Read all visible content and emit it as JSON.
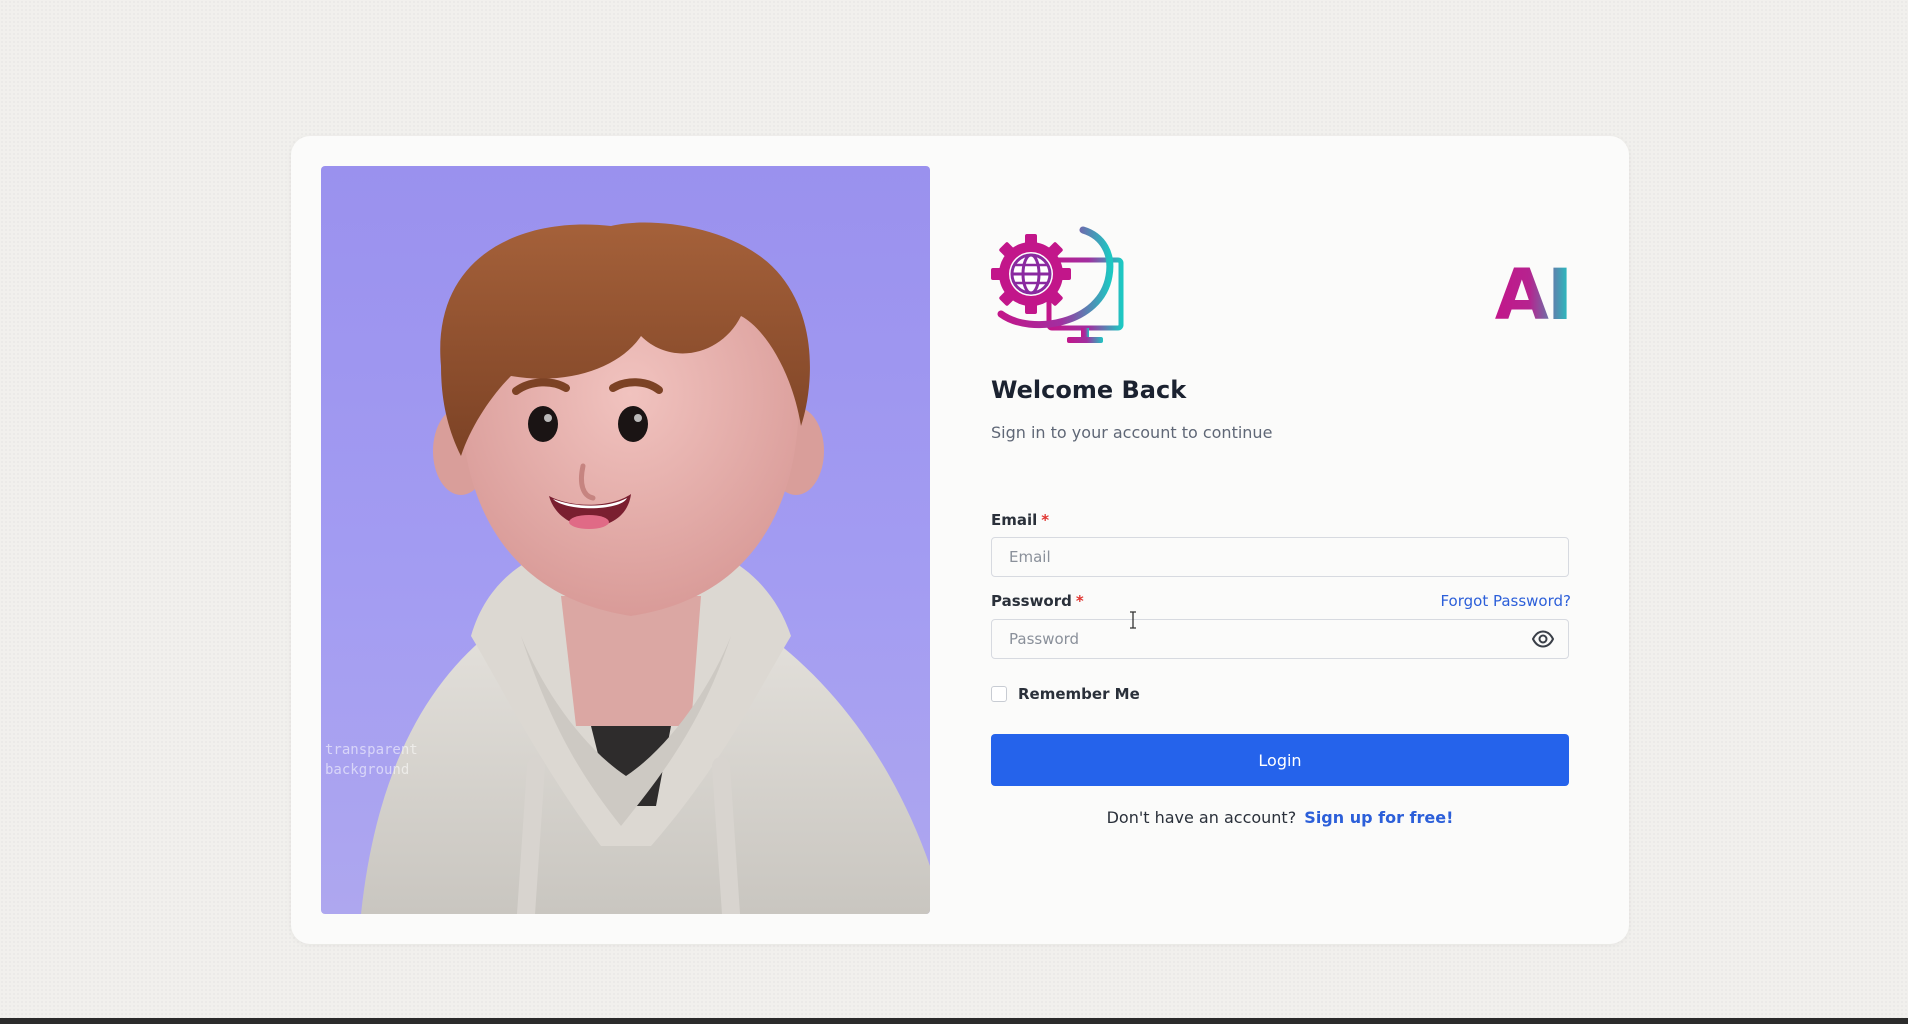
{
  "brand": {
    "logo_icon": "globe-gear-monitor-logo",
    "mark_text": "AI",
    "gradient": [
      "#c2168a",
      "#1ec7c2"
    ]
  },
  "hero": {
    "image": "3d-avatar-boy-in-hoodie",
    "background_color": "#9a91ee",
    "watermark_line1": "transparent",
    "watermark_line2": "background"
  },
  "form": {
    "title": "Welcome Back",
    "subtitle": "Sign in to your account to continue",
    "email": {
      "label": "Email",
      "required_mark": "*",
      "placeholder": "Email",
      "value": ""
    },
    "password": {
      "label": "Password",
      "required_mark": "*",
      "placeholder": "Password",
      "value": "",
      "toggle_icon": "eye-icon"
    },
    "forgot_link": "Forgot Password?",
    "remember_label": "Remember Me",
    "remember_checked": false,
    "login_label": "Login",
    "signup_prompt": "Don't have an account?",
    "signup_link": "Sign up for free!"
  },
  "colors": {
    "primary": "#2563eb",
    "link": "#2c5fd9",
    "required": "#e0342f"
  }
}
